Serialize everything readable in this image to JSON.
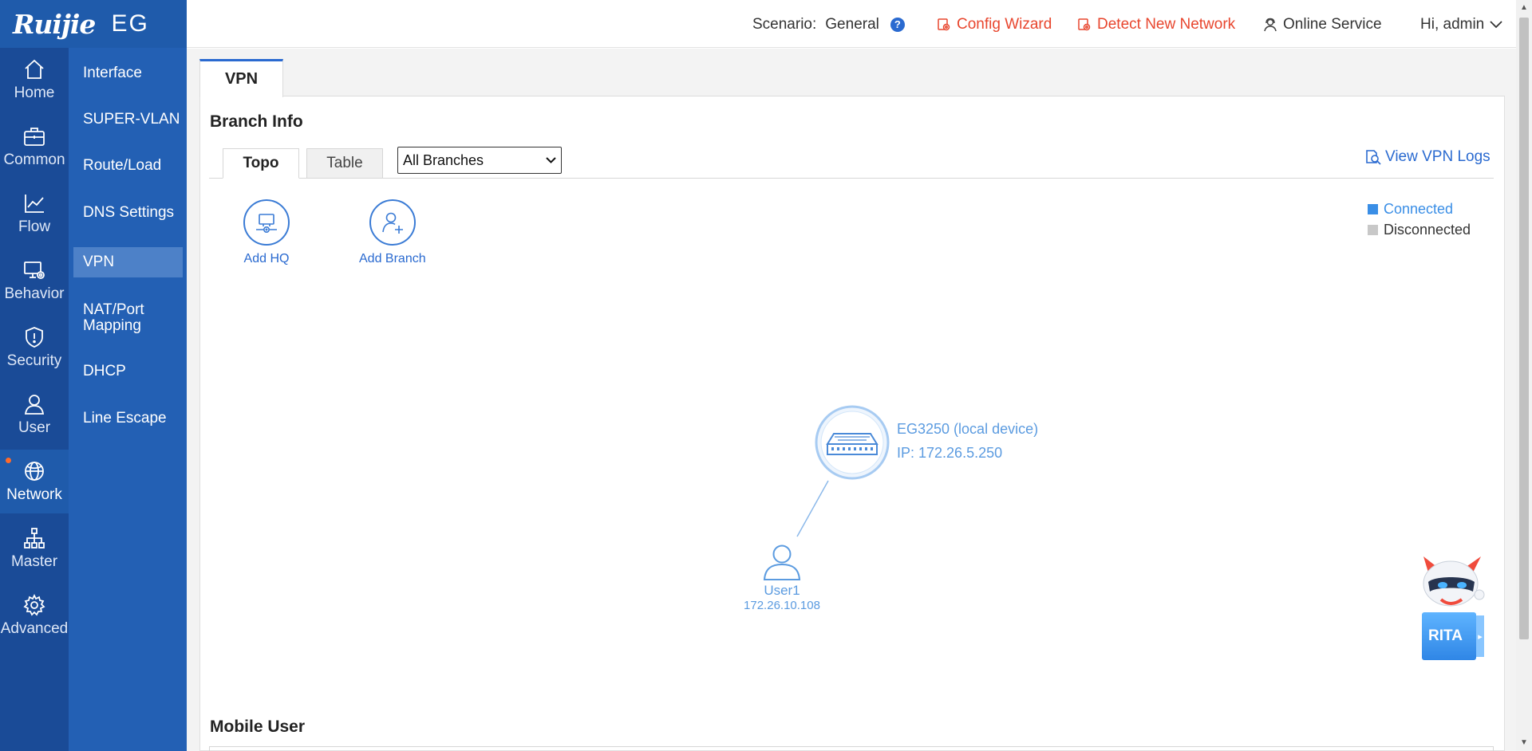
{
  "brand": {
    "logo": "Ruijie",
    "product": "EG"
  },
  "rail": [
    {
      "label": "Home",
      "icon": "home-icon"
    },
    {
      "label": "Common",
      "icon": "briefcase-icon"
    },
    {
      "label": "Flow",
      "icon": "line-chart-icon"
    },
    {
      "label": "Behavior",
      "icon": "monitor-gear-icon"
    },
    {
      "label": "Security",
      "icon": "shield-alert-icon"
    },
    {
      "label": "User",
      "icon": "user-icon"
    },
    {
      "label": "Network",
      "icon": "globe-icon",
      "active": true
    },
    {
      "label": "Master",
      "icon": "sitemap-icon"
    },
    {
      "label": "Advanced",
      "icon": "gear-icon"
    }
  ],
  "submenu": [
    {
      "label": "Interface"
    },
    {
      "label": "SUPER-VLAN"
    },
    {
      "label": "Route/Load"
    },
    {
      "label": "DNS Settings"
    },
    {
      "label": "VPN",
      "active": true
    },
    {
      "label": "NAT/Port\nMapping"
    },
    {
      "label": "DHCP"
    },
    {
      "label": "Line Escape"
    }
  ],
  "header": {
    "scenario_label": "Scenario:",
    "scenario_value": "General",
    "help": "?",
    "config_wizard": "Config Wizard",
    "detect_network": "Detect New Network",
    "online_service": "Online Service",
    "greeting": "Hi, admin"
  },
  "main_tab": "VPN",
  "branch_info": {
    "title": "Branch Info",
    "tabs": [
      "Topo",
      "Table"
    ],
    "active_tab": "Topo",
    "select_value": "All Branches",
    "view_logs": "View VPN Logs"
  },
  "legend": {
    "connected": "Connected",
    "disconnected": "Disconnected",
    "connected_color": "#3a8ee6",
    "disconnected_color": "#c8c8c8"
  },
  "actions": {
    "add_hq": "Add HQ",
    "add_branch": "Add Branch"
  },
  "topology": {
    "device_name": "EG3250 (local device)",
    "device_ip": "IP: 172.26.5.250",
    "user_name": "User1",
    "user_ip": "172.26.10.108"
  },
  "mobile_user_title": "Mobile User",
  "rita_label": "RITA",
  "colors": {
    "rail": "#1a4b97",
    "submenu": "#2360b4",
    "accent": "#2a6ad0",
    "alert": "#e8462e",
    "topo": "#5b9be0"
  }
}
